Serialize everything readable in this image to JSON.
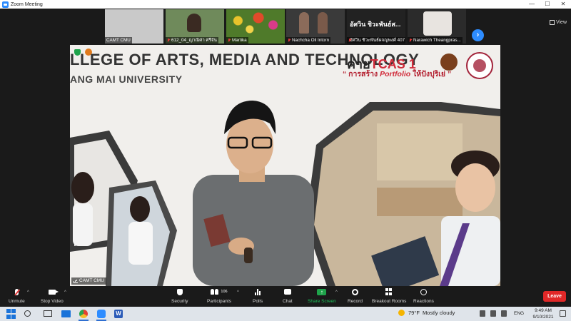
{
  "window": {
    "title": "Zoom Meeting",
    "controls": [
      "—",
      "☐",
      "✕"
    ]
  },
  "participants_strip": {
    "tiles": [
      {
        "name": "CAMT CMU",
        "muted": false
      },
      {
        "name": "612_04_ญาณิศา ศรีจัน",
        "muted": true
      },
      {
        "name": "Martika",
        "muted": true
      },
      {
        "name": "Nachcha Oil Intorn",
        "muted": true
      },
      {
        "name": "อัศวิน ชิวะพันธ์ผจญพงศ์ 407",
        "display": "อัศวิน ชิวะพันธ์ส...",
        "muted": true
      },
      {
        "name": "Narawich Theangpras...",
        "muted": true
      }
    ],
    "next_arrow": "›",
    "view_label": "View"
  },
  "main_video": {
    "speaker_name": "CAMT CMU",
    "background_text_line1": "LLEGE OF ARTS, MEDIA AND TECHNOLOGY",
    "background_text_line2": "ANG MAI UNIVERSITY",
    "banner_prefix": "ค่าย",
    "banner_tcas": "TCAS 1",
    "banner_subtitle_pre": "“ การสร้าง ",
    "banner_subtitle_portfolio": "Portfolio",
    "banner_subtitle_post": " ให้ปังปุริเย่ ”"
  },
  "toolbar": {
    "unmute": "Unmute",
    "stop_video": "Stop Video",
    "security": "Security",
    "participants": "Participants",
    "participant_count": "106",
    "polls": "Polls",
    "chat": "Chat",
    "share_screen": "Share Screen",
    "record": "Record",
    "breakout_rooms": "Breakout Rooms",
    "reactions": "Reactions",
    "leave": "Leave",
    "caret": "^",
    "share_arrow": "↑"
  },
  "taskbar": {
    "weather_temp": "79°F",
    "weather_desc": "Mostly cloudy",
    "language": "ENG",
    "time": "9:49 AM",
    "date": "9/10/2021",
    "word_letter": "W"
  },
  "colors": {
    "zoom_blue": "#2d8cff",
    "leave_red": "#e02828",
    "share_green": "#1ea34a",
    "banner_red": "#d12b3a"
  }
}
